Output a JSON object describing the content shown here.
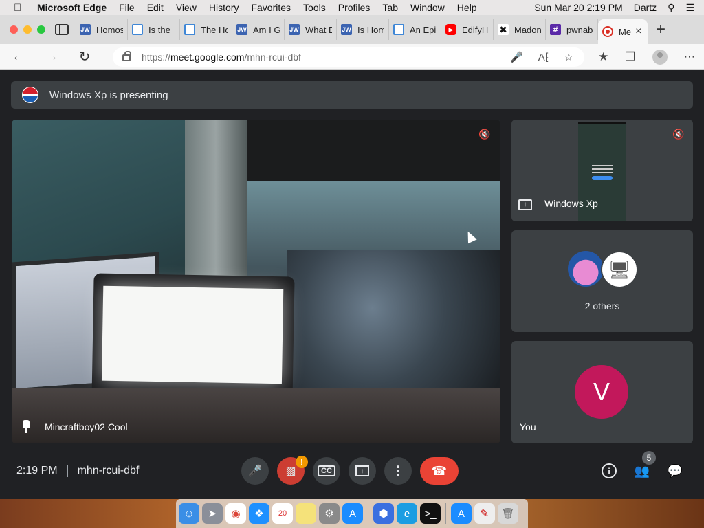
{
  "menubar": {
    "app": "Microsoft Edge",
    "items": [
      "File",
      "Edit",
      "View",
      "History",
      "Favorites",
      "Tools",
      "Profiles",
      "Tab",
      "Window",
      "Help"
    ],
    "datetime": "Sun Mar 20  2:19 PM",
    "user": "Dartz"
  },
  "tabs": [
    {
      "label": "Homos",
      "icon": "jw"
    },
    {
      "label": "Is the",
      "icon": "doc"
    },
    {
      "label": "The Ho",
      "icon": "doc"
    },
    {
      "label": "Am I G",
      "icon": "jw"
    },
    {
      "label": "What D",
      "icon": "jw"
    },
    {
      "label": "Is Hom",
      "icon": "jw"
    },
    {
      "label": "An Epi",
      "icon": "doc"
    },
    {
      "label": "EdifyH",
      "icon": "yt"
    },
    {
      "label": "Madon",
      "icon": "x"
    },
    {
      "label": "pwnab",
      "icon": "hash"
    },
    {
      "label": "Me",
      "icon": "rec",
      "active": true
    }
  ],
  "address": {
    "scheme": "https://",
    "host": "meet.google.com",
    "path": "/mhn-rcui-dbf"
  },
  "meet": {
    "presenting_text": "Windows Xp is presenting",
    "main_tile_name": "Mincraftboy02 Cool",
    "side_tiles": {
      "presenter_name": "Windows Xp",
      "others_label": "2 others",
      "self_label": "You",
      "self_initial": "V"
    },
    "footer": {
      "time": "2:19 PM",
      "meeting_code": "mhn-rcui-dbf",
      "participant_count": "5"
    }
  },
  "colors": {
    "meet_bg": "#202124",
    "tile_bg": "#3c4043",
    "end_call": "#ea4335",
    "self_avatar": "#c2185b"
  }
}
